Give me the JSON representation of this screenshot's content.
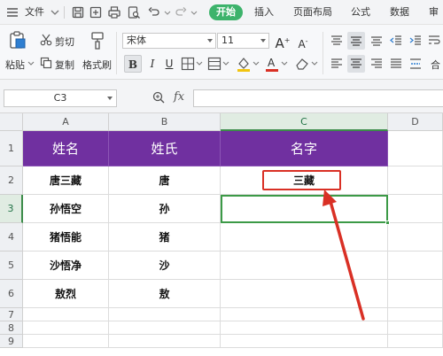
{
  "menu": {
    "file": "文件",
    "tabs": [
      "开始",
      "插入",
      "页面布局",
      "公式",
      "数据",
      "审"
    ],
    "active_tab_color": "#3db36b"
  },
  "ribbon": {
    "paste": "粘贴",
    "cut": "剪切",
    "copy": "复制",
    "format_painter": "格式刷",
    "font_name": "宋体",
    "font_size": "11",
    "bold": "B",
    "italic": "I",
    "underline": "U",
    "font_color_letter": "A",
    "grow_font": "A",
    "shrink_font": "A",
    "overflow": "合"
  },
  "formula_bar": {
    "cell_ref": "C3",
    "fx": "fx",
    "value": ""
  },
  "grid": {
    "columns": [
      "A",
      "B",
      "C",
      "D"
    ],
    "active_column": "C",
    "rows": [
      "1",
      "2",
      "3",
      "4",
      "5",
      "6",
      "7",
      "8",
      "9"
    ],
    "active_row": "3",
    "header_row": [
      "姓名",
      "姓氏",
      "名字"
    ],
    "data": [
      [
        "唐三藏",
        "唐",
        "三藏"
      ],
      [
        "孙悟空",
        "孙",
        ""
      ],
      [
        "猪悟能",
        "猪",
        ""
      ],
      [
        "沙悟净",
        "沙",
        ""
      ],
      [
        "敖烈",
        "敖",
        ""
      ]
    ],
    "header_fill": "#7030a0",
    "selection_color": "#3c9a47",
    "callout_color": "#d93025"
  }
}
